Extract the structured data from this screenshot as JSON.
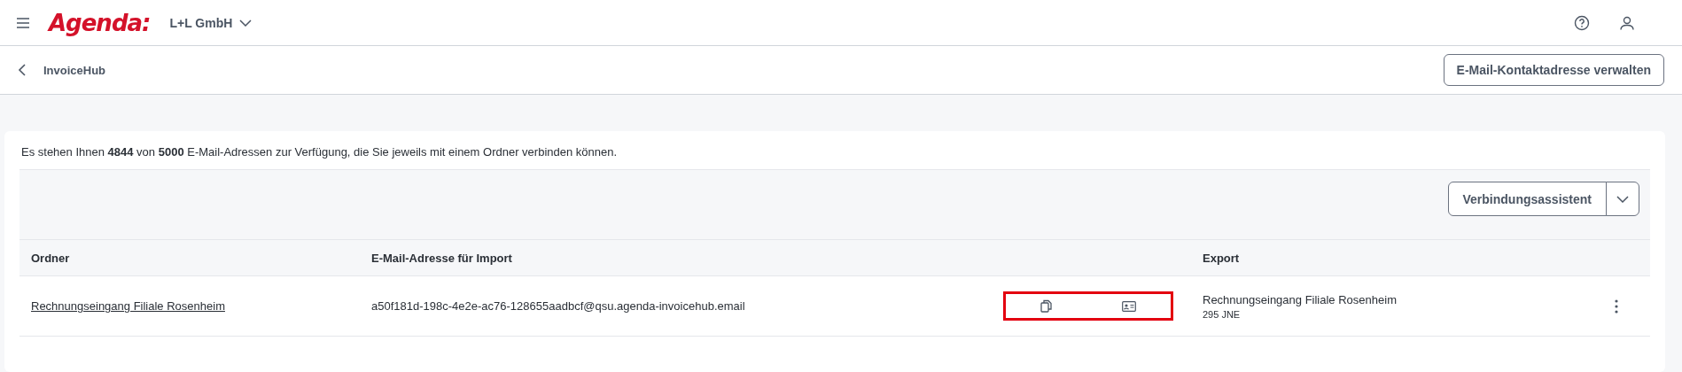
{
  "topbar": {
    "logo": "Agenda:",
    "company": "L+L GmbH"
  },
  "subbar": {
    "title": "InvoiceHub",
    "button": "E-Mail-Kontaktadresse verwalten"
  },
  "info": "Es stehen Ihnen **4844** von **5000** E-Mail-Adressen zur Verfügung, die Sie jeweils mit einem Ordner verbinden können.",
  "toolbar": {
    "button": "Verbindungsassistent"
  },
  "table": {
    "columns": [
      "Ordner",
      "E-Mail-Adresse für Import",
      "Export"
    ],
    "rows": [
      {
        "folder": "Rechnungseingang Filiale Rosenheim",
        "email": "a50f181d-198c-4e2e-ac76-128655aadbcf@qsu.agenda-invoicehub.email",
        "export": "Rechnungseingang Filiale Rosenheim",
        "export_sub": "295 JNE",
        "highlighted": true
      }
    ]
  }
}
